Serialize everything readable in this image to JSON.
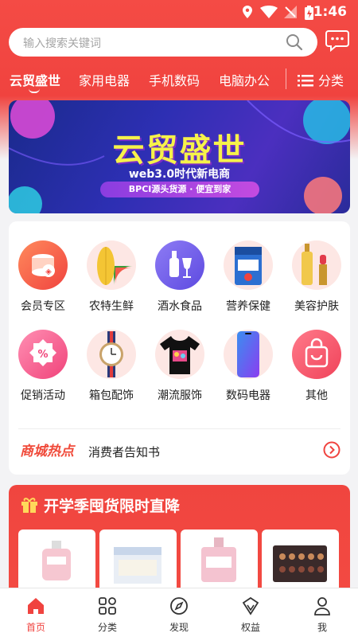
{
  "status_bar": {
    "time": "1:46"
  },
  "search": {
    "placeholder": "输入搜索关键词"
  },
  "categories": [
    "云贸盛世",
    "家用电器",
    "手机数码",
    "电脑办公"
  ],
  "category_all_label": "分类",
  "banner": {
    "title": "云贸盛世",
    "subtitle": "web3.0时代新电商",
    "ribbon": "BPCI源头货源 · 便宜到家"
  },
  "grid": [
    {
      "label": "会员专区",
      "icon": "member-icon"
    },
    {
      "label": "农特生鲜",
      "icon": "fresh-produce-icon"
    },
    {
      "label": "酒水食品",
      "icon": "wine-icon"
    },
    {
      "label": "营养保健",
      "icon": "nutrition-icon"
    },
    {
      "label": "美容护肤",
      "icon": "skincare-icon"
    },
    {
      "label": "促销活动",
      "icon": "promotion-icon"
    },
    {
      "label": "箱包配饰",
      "icon": "watch-icon"
    },
    {
      "label": "潮流服饰",
      "icon": "tshirt-icon"
    },
    {
      "label": "数码电器",
      "icon": "phone-icon"
    },
    {
      "label": "其他",
      "icon": "bag-icon"
    }
  ],
  "notice": {
    "logo": "商城热点",
    "text": "消费者告知书"
  },
  "promo": {
    "title": "开学季囤货限时直降"
  },
  "tabs": [
    {
      "label": "首页",
      "icon": "home-icon",
      "active": true
    },
    {
      "label": "分类",
      "icon": "grid-icon",
      "active": false
    },
    {
      "label": "发现",
      "icon": "compass-icon",
      "active": false
    },
    {
      "label": "权益",
      "icon": "shield-icon",
      "active": false
    },
    {
      "label": "我",
      "icon": "user-icon",
      "active": false
    }
  ],
  "colors": {
    "brand_red": "#f0433f",
    "active_tab": "#f0433f"
  }
}
